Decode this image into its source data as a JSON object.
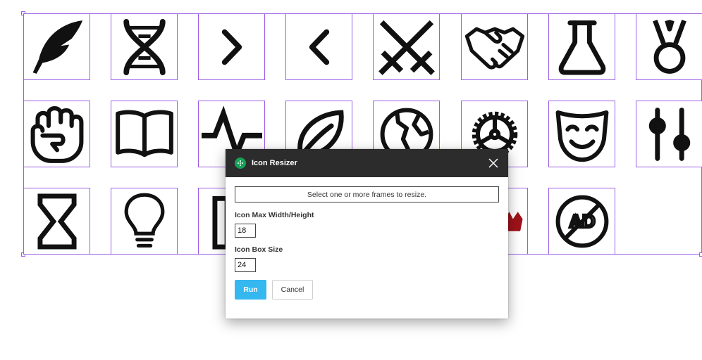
{
  "canvas": {
    "selection_color": "#9b5de5",
    "icons": [
      {
        "name": "quill-icon"
      },
      {
        "name": "dna-icon"
      },
      {
        "name": "chevron-right-icon"
      },
      {
        "name": "chevron-left-icon"
      },
      {
        "name": "crossed-swords-icon"
      },
      {
        "name": "handshake-icon"
      },
      {
        "name": "flask-icon"
      },
      {
        "name": "medal-icon"
      },
      {
        "name": "fist-icon"
      },
      {
        "name": "open-book-icon"
      },
      {
        "name": "heartbeat-icon"
      },
      {
        "name": "leaf-icon"
      },
      {
        "name": "globe-icon"
      },
      {
        "name": "gear-icon"
      },
      {
        "name": "theater-mask-icon"
      },
      {
        "name": "sliders-icon"
      },
      {
        "name": "hourglass-icon"
      },
      {
        "name": "lightbulb-icon"
      },
      {
        "name": "pillar-icon"
      },
      {
        "name": "crown-icon"
      },
      {
        "name": "no-ads-icon"
      }
    ]
  },
  "dialog": {
    "title": "Icon Resizer",
    "message": "Select one or more frames to resize.",
    "max_size_label": "Icon Max Width/Height",
    "max_size_value": "18",
    "box_size_label": "Icon Box Size",
    "box_size_value": "24",
    "run_label": "Run",
    "cancel_label": "Cancel",
    "accent_color": "#35b7f0",
    "header_color": "#2c2c2c"
  }
}
